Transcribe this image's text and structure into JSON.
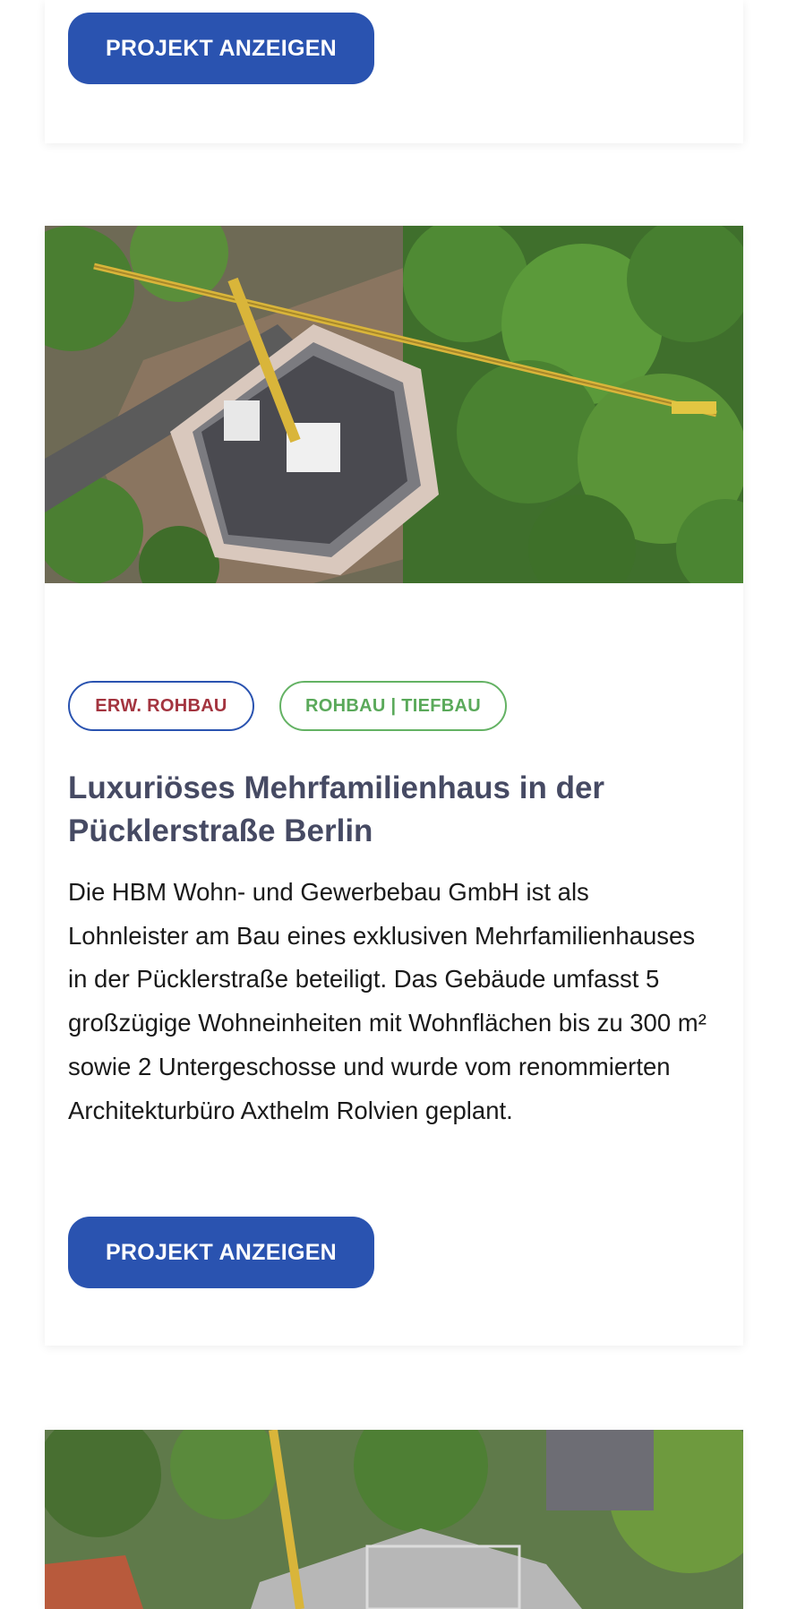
{
  "cards": [
    {
      "button_label": "PROJEKT ANZEIGEN"
    },
    {
      "tags": [
        "ERW. ROHBAU",
        "ROHBAU | TIEFBAU"
      ],
      "title": "Luxuriöses Mehrfamilienhaus in der Pücklerstraße Berlin",
      "description": "Die HBM Wohn- und Gewerbebau GmbH ist als Lohnleister am Bau eines exklusiven Mehrfamilienhauses in der Pücklerstraße beteiligt. Das Gebäude umfasst 5 großzügige Wohneinheiten mit Wohnflächen bis zu 300 m² sowie 2 Untergeschosse und wurde vom renommierten Architekturbüro Axthelm Rolvien geplant.",
      "button_label": "PROJEKT ANZEIGEN",
      "image": "aerial-construction-site-crane-photo"
    },
    {
      "image": "aerial-construction-site-scaffolding-photo"
    }
  ],
  "colors": {
    "button": "#2a53b0",
    "tag_rohbau_text": "#a3343f",
    "tag_rohbau_border": "#2a53b0",
    "tag_tiefbau": "#5aa95a",
    "title": "#464a63"
  }
}
